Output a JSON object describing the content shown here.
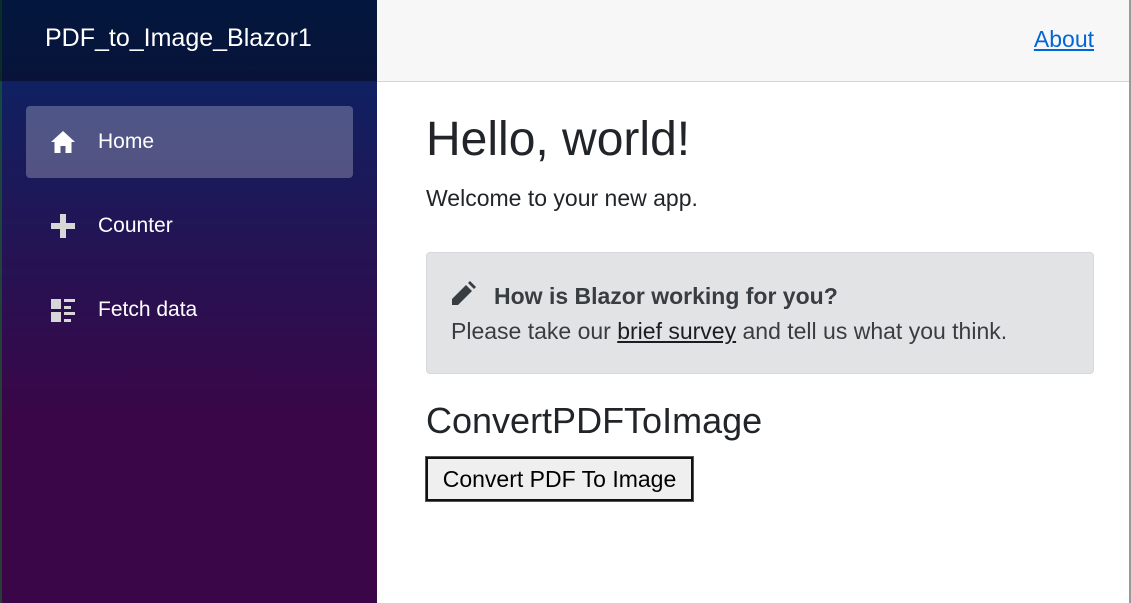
{
  "app": {
    "brand": "PDF_to_Image_Blazor1"
  },
  "nav": {
    "items": [
      {
        "label": "Home",
        "icon": "home-icon",
        "active": true
      },
      {
        "label": "Counter",
        "icon": "plus-icon",
        "active": false
      },
      {
        "label": "Fetch data",
        "icon": "list-rich-icon",
        "active": false
      }
    ]
  },
  "top_row": {
    "about_label": "About"
  },
  "main": {
    "title": "Hello, world!",
    "welcome": "Welcome to your new app.",
    "survey": {
      "icon": "pencil-icon",
      "heading": "How is Blazor working for you?",
      "text_before": "Please take our ",
      "link_label": "brief survey",
      "text_after": " and tell us what you think."
    },
    "section_title": "ConvertPDFToImage",
    "convert_button": "Convert PDF To Image"
  },
  "colors": {
    "sidebar_top": "#052767",
    "sidebar_bottom": "#3a0647",
    "link": "#0366d6",
    "alert_bg": "#e2e3e5"
  }
}
